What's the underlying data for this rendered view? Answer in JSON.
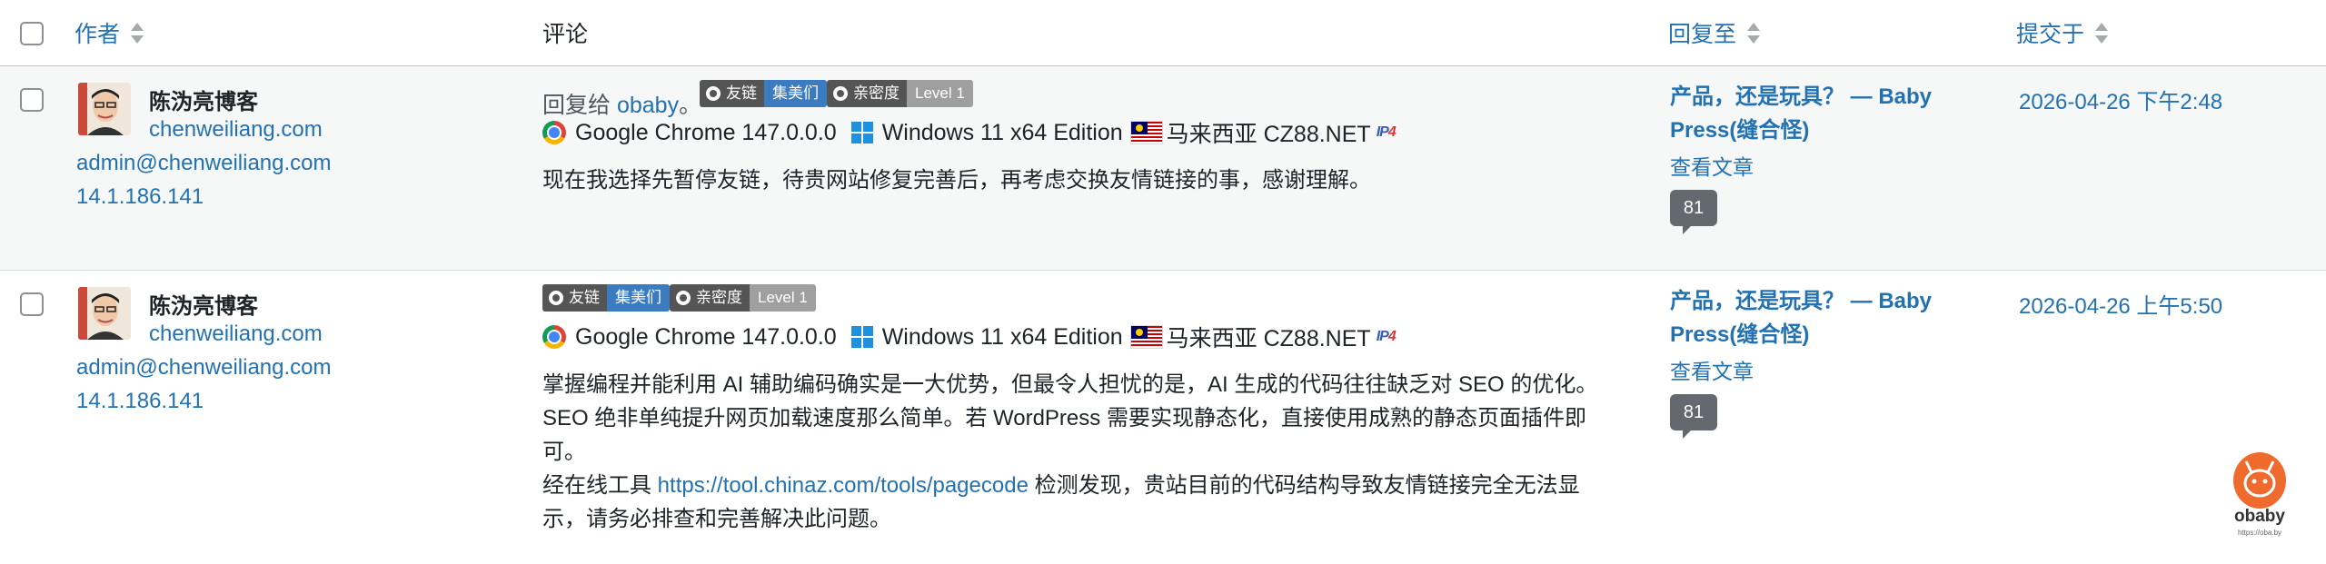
{
  "header": {
    "author_label": "作者",
    "comment_label": "评论",
    "response_label": "回复至",
    "submitted_label": "提交于"
  },
  "comments": [
    {
      "author": {
        "name": "陈沩亮博客",
        "url": "chenweiliang.com",
        "email": "admin@chenweiliang.com",
        "ip": "14.1.186.141"
      },
      "reply_prefix": "回复给",
      "reply_to": "obaby",
      "reply_suffix": "。",
      "badges": [
        {
          "label": "友链",
          "value": "集美们",
          "color": "#3b7bbf"
        },
        {
          "label": "亲密度",
          "value": "Level 1",
          "color": "#9f9f9f"
        }
      ],
      "browser": "Google Chrome 147.0.0.0",
      "os": "Windows 11 x64 Edition",
      "location": "马来西亚 CZ88.NET",
      "text_lines": [
        "现在我选择先暂停友链，待贵网站修复完善后，再考虑交换友情链接的事，感谢理解。"
      ],
      "response": {
        "title": "产品，还是玩具？ — Baby Press(缝合怪)",
        "view_label": "查看文章",
        "count": "81"
      },
      "date": "2026-04-26 下午2:48"
    },
    {
      "author": {
        "name": "陈沩亮博客",
        "url": "chenweiliang.com",
        "email": "admin@chenweiliang.com",
        "ip": "14.1.186.141"
      },
      "badges": [
        {
          "label": "友链",
          "value": "集美们",
          "color": "#3b7bbf"
        },
        {
          "label": "亲密度",
          "value": "Level 1",
          "color": "#9f9f9f"
        }
      ],
      "browser": "Google Chrome 147.0.0.0",
      "os": "Windows 11 x64 Edition",
      "location": "马来西亚 CZ88.NET",
      "text_lines": [
        "掌握编程并能利用 AI 辅助编码确实是一大优势，但最令人担忧的是，AI 生成的代码往往缺乏对 SEO 的优化。",
        "SEO 绝非单纯提升网页加载速度那么简单。若 WordPress 需要实现静态化，直接使用成熟的静态页面插件即",
        "可。"
      ],
      "text_prefix2": "经在线工具",
      "text_link": "https://tool.chinaz.com/tools/pagecode",
      "text_suffix2": "检测发现，贵站目前的代码结构导致友情链接完全无法显",
      "text_last": "示，请务必排查和完善解决此问题。",
      "response": {
        "title": "产品，还是玩具？ — Baby Press(缝合怪)",
        "view_label": "查看文章",
        "count": "81"
      },
      "date": "2026-04-26 上午5:50"
    }
  ],
  "watermark": {
    "name": "obaby",
    "url": "https://oba.by"
  }
}
